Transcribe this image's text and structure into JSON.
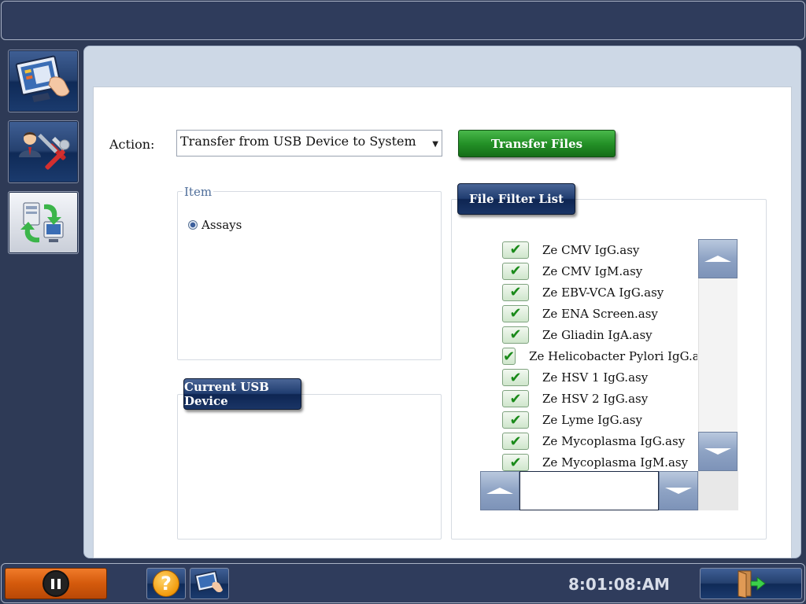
{
  "sidebar": {
    "items": [
      {
        "icon": "touchscreen-monitor-icon"
      },
      {
        "icon": "user-tools-icon"
      },
      {
        "icon": "file-transfer-icon",
        "active": true
      }
    ]
  },
  "action": {
    "label": "Action:",
    "selected": "Transfer from USB Device to System",
    "transfer_button": "Transfer Files"
  },
  "item_group": {
    "legend": "Item",
    "option": "Assays"
  },
  "usb_group": {
    "button": "Current USB Device"
  },
  "file_filter": {
    "button": "File Filter List",
    "files": [
      "Ze CMV IgG.asy",
      "Ze CMV IgM.asy",
      "Ze EBV-VCA IgG.asy",
      "Ze ENA Screen.asy",
      "Ze Gliadin IgA.asy",
      "Ze Helicobacter Pylori IgG.asy",
      "Ze HSV 1 IgG.asy",
      "Ze HSV 2 IgG.asy",
      "Ze Lyme IgG.asy",
      "Ze Mycoplasma IgG.asy",
      "Ze Mycoplasma IgM.asy"
    ],
    "check_glyph": "✔",
    "hscroll_value": ""
  },
  "footer": {
    "clock": "8:01:08:AM",
    "help_glyph": "?"
  },
  "colors": {
    "background": "#2e3a56",
    "transfer_green": "#249127",
    "pause_orange": "#d45a0c",
    "navy_button": "#203d70"
  }
}
